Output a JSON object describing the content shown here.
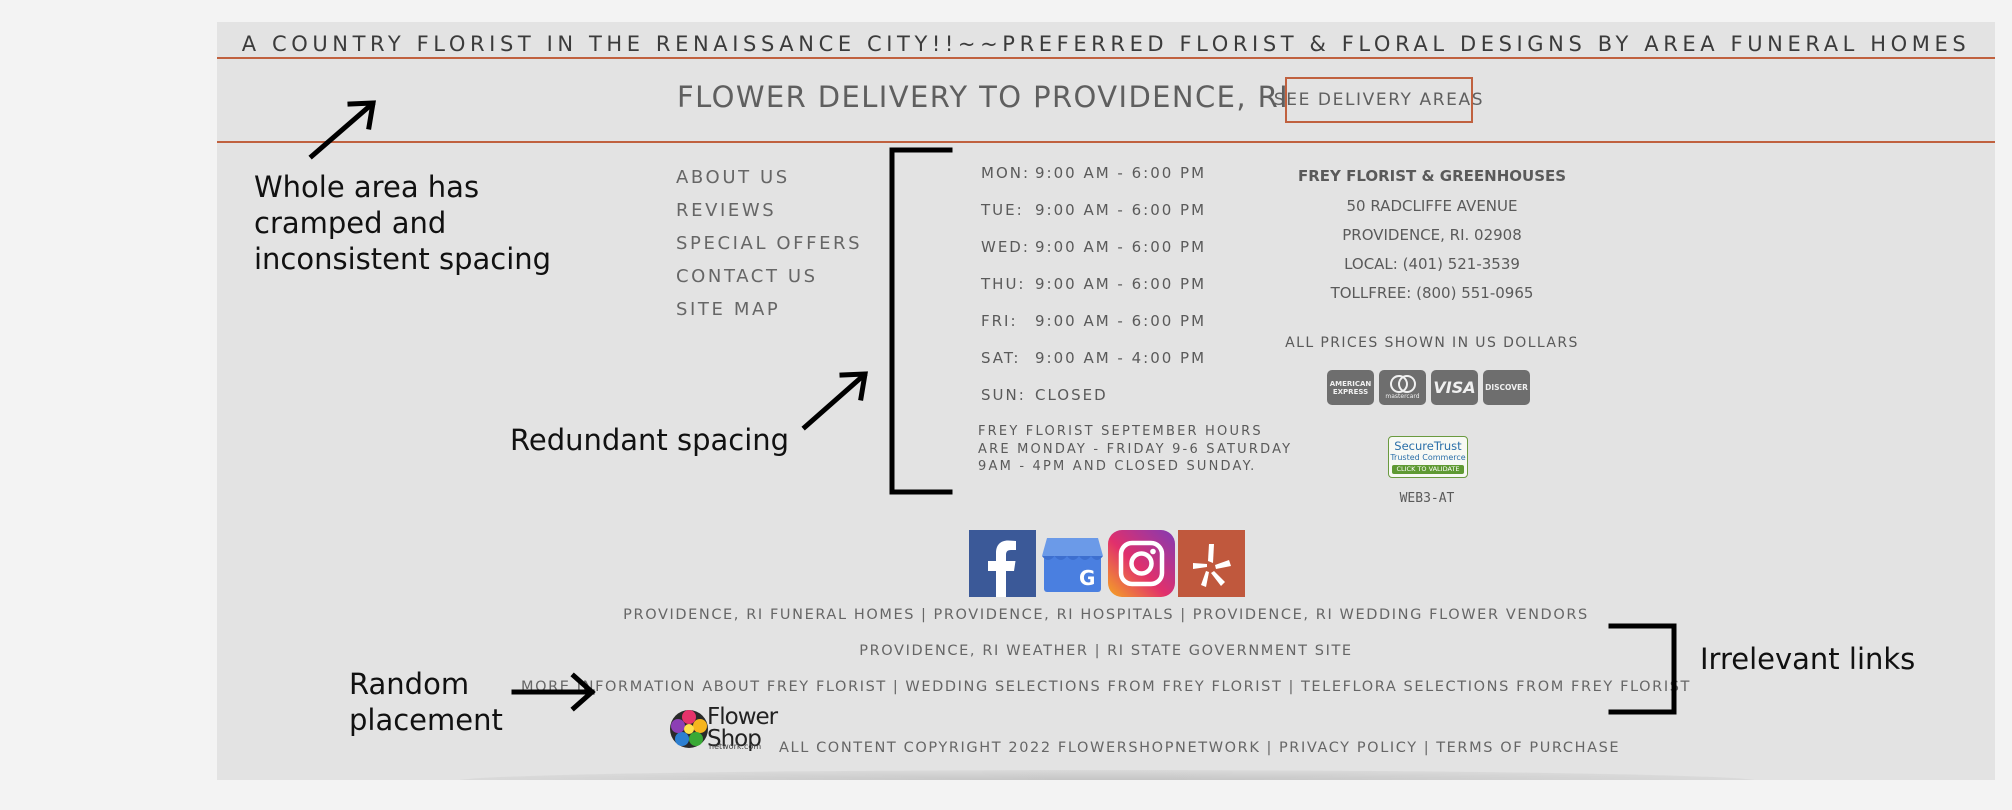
{
  "header": {
    "tagline": "A COUNTRY FLORIST IN THE RENAISSANCE CITY!!~~PREFERRED FLORIST & FLORAL DESIGNS BY AREA FUNERAL HOMES",
    "delivery_title": "FLOWER DELIVERY TO PROVIDENCE, RI",
    "delivery_button": "SEE DELIVERY AREAS"
  },
  "nav": [
    "ABOUT US",
    "REVIEWS",
    "SPECIAL OFFERS",
    "CONTACT US",
    "SITE MAP"
  ],
  "hours": [
    {
      "day": "MON:",
      "time": "9:00 AM - 6:00 PM"
    },
    {
      "day": "TUE:",
      "time": "9:00 AM - 6:00 PM"
    },
    {
      "day": "WED:",
      "time": "9:00 AM - 6:00 PM"
    },
    {
      "day": "THU:",
      "time": "9:00 AM - 6:00 PM"
    },
    {
      "day": "FRI:",
      "time": "9:00 AM - 6:00 PM"
    },
    {
      "day": "SAT:",
      "time": "9:00 AM - 4:00 PM"
    },
    {
      "day": "SUN:",
      "time": "CLOSED"
    }
  ],
  "hours_note": "Frey Florist September hours are Monday - Friday 9-6 Saturday 9am - 4pm and closed Sunday.",
  "address": {
    "name": "FREY FLORIST & GREENHOUSES",
    "street": "50 RADCLIFFE AVENUE",
    "city": "PROVIDENCE, RI. 02908",
    "local": "LOCAL: (401) 521-3539",
    "tollfree": "TOLLFREE: (800) 551-0965"
  },
  "prices_note": "ALL PRICES SHOWN IN US DOLLARS",
  "payment_cards": [
    {
      "icon": "amex-card-icon",
      "label": "AMERICAN EXPRESS"
    },
    {
      "icon": "mastercard-card-icon",
      "label": "mastercard"
    },
    {
      "icon": "visa-card-icon",
      "label": "VISA"
    },
    {
      "icon": "discover-card-icon",
      "label": "DISCOVER"
    }
  ],
  "securetrust": {
    "title": "SecureTrust",
    "subtitle": "Trusted Commerce",
    "cta": "CLICK TO VALIDATE"
  },
  "server_code": "WEB3-AT",
  "social": [
    {
      "icon": "facebook-icon",
      "color": "#3b5998"
    },
    {
      "icon": "google-business-icon",
      "color": "#4a7fe0"
    },
    {
      "icon": "instagram-icon",
      "color": "#c13584"
    },
    {
      "icon": "yelp-icon",
      "color": "#c0583d"
    }
  ],
  "links_row1": [
    "PROVIDENCE, RI FUNERAL HOMES",
    "PROVIDENCE, RI HOSPITALS",
    "PROVIDENCE, RI WEDDING FLOWER VENDORS"
  ],
  "links_row2": [
    "PROVIDENCE, RI WEATHER",
    "RI STATE GOVERNMENT SITE"
  ],
  "links_row3": [
    "MORE INFORMATION ABOUT FREY FLORIST",
    "WEDDING SELECTIONS FROM FREY FLORIST",
    "TELEFLORA SELECTIONS FROM FREY FLORIST"
  ],
  "footer": {
    "logo_line1": "Flower",
    "logo_line2": "Shop",
    "logo_sub": "network.com",
    "copyright": "ALL CONTENT COPYRIGHT 2022 FLOWERSHOPNETWORK",
    "privacy": "PRIVACY POLICY",
    "terms": "TERMS OF PURCHASE"
  },
  "annotations": {
    "spacing_note": [
      "Whole area has",
      "cramped and",
      "inconsistent spacing"
    ],
    "redundant_note": "Redundant spacing",
    "random_note": [
      "Random",
      "placement"
    ],
    "irrelevant_note": "Irrelevant links"
  },
  "colors": {
    "accent": "#c0613f",
    "panel": "#e3e3e3",
    "text": "#5a5a5a"
  }
}
